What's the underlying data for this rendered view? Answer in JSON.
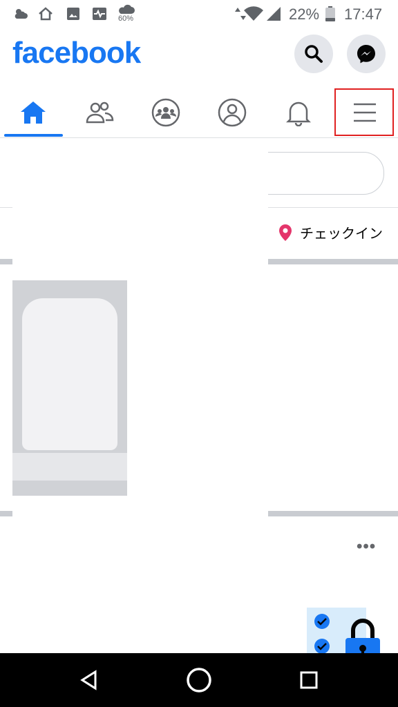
{
  "status_bar": {
    "battery": "22%",
    "time": "17:47",
    "weather_badge": "60%",
    "icons": [
      "weather-icon",
      "home-icon",
      "gallery-icon",
      "activity-icon",
      "cloud-icon",
      "data-arrows-icon",
      "wifi-icon",
      "signal-icon",
      "battery-icon"
    ]
  },
  "header": {
    "logo": "facebook",
    "search_icon": "search-icon",
    "messenger_icon": "messenger-icon"
  },
  "tabs": [
    {
      "name": "home",
      "icon": "home-icon",
      "active": true
    },
    {
      "name": "friends",
      "icon": "friends-icon",
      "active": false
    },
    {
      "name": "groups",
      "icon": "groups-icon",
      "active": false
    },
    {
      "name": "profile",
      "icon": "profile-icon",
      "active": false
    },
    {
      "name": "notifications",
      "icon": "bell-icon",
      "active": false
    },
    {
      "name": "menu",
      "icon": "hamburger-icon",
      "active": false,
      "highlighted": true
    }
  ],
  "composer": {
    "checkin_label": "チェックイン"
  },
  "post": {
    "more_label": "•••"
  },
  "colors": {
    "brand": "#1877f2",
    "highlight": "#e02020",
    "checkin_pin": "#e4356b"
  }
}
